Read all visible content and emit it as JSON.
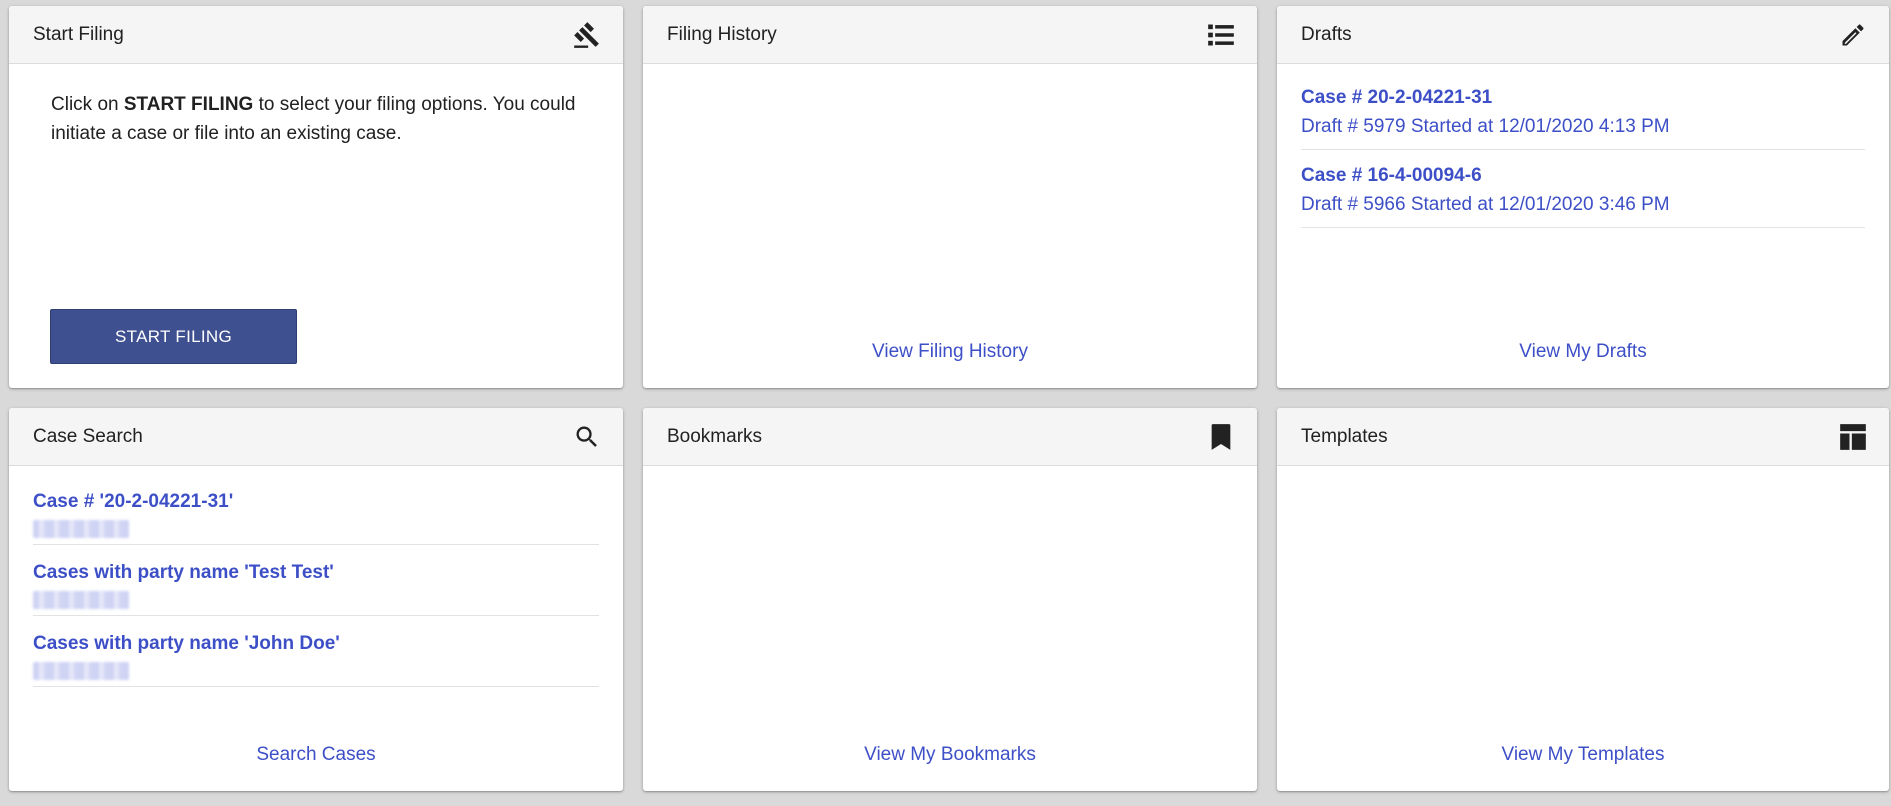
{
  "start_filing": {
    "title": "Start Filing",
    "icon": "gavel-icon",
    "intro_prefix": "Click on ",
    "intro_bold": "START FILING",
    "intro_suffix": " to select your filing options. You could initiate a case or file into an existing case.",
    "button_label": "START FILING"
  },
  "filing_history": {
    "title": "Filing History",
    "icon": "list-icon",
    "footer_link": "View Filing History"
  },
  "drafts": {
    "title": "Drafts",
    "icon": "pencil-icon",
    "items": [
      {
        "case": "Case # 20-2-04221-31",
        "detail": "Draft # 5979 Started at 12/01/2020 4:13 PM"
      },
      {
        "case": "Case # 16-4-00094-6",
        "detail": "Draft # 5966 Started at 12/01/2020 3:46 PM"
      }
    ],
    "footer_link": "View My Drafts"
  },
  "case_search": {
    "title": "Case Search",
    "icon": "search-icon",
    "items": [
      {
        "query": "Case # '20-2-04221-31'"
      },
      {
        "query": "Cases with party name 'Test Test'"
      },
      {
        "query": "Cases with party name 'John Doe'"
      }
    ],
    "footer_link": "Search Cases"
  },
  "bookmarks": {
    "title": "Bookmarks",
    "icon": "bookmark-icon",
    "footer_link": "View My Bookmarks"
  },
  "templates": {
    "title": "Templates",
    "icon": "template-layout-icon",
    "footer_link": "View My Templates"
  },
  "colors": {
    "link": "#3d4fc7",
    "button_bg": "#3f5090",
    "header_bg": "#f5f5f5",
    "page_bg": "#d9d9d9"
  }
}
